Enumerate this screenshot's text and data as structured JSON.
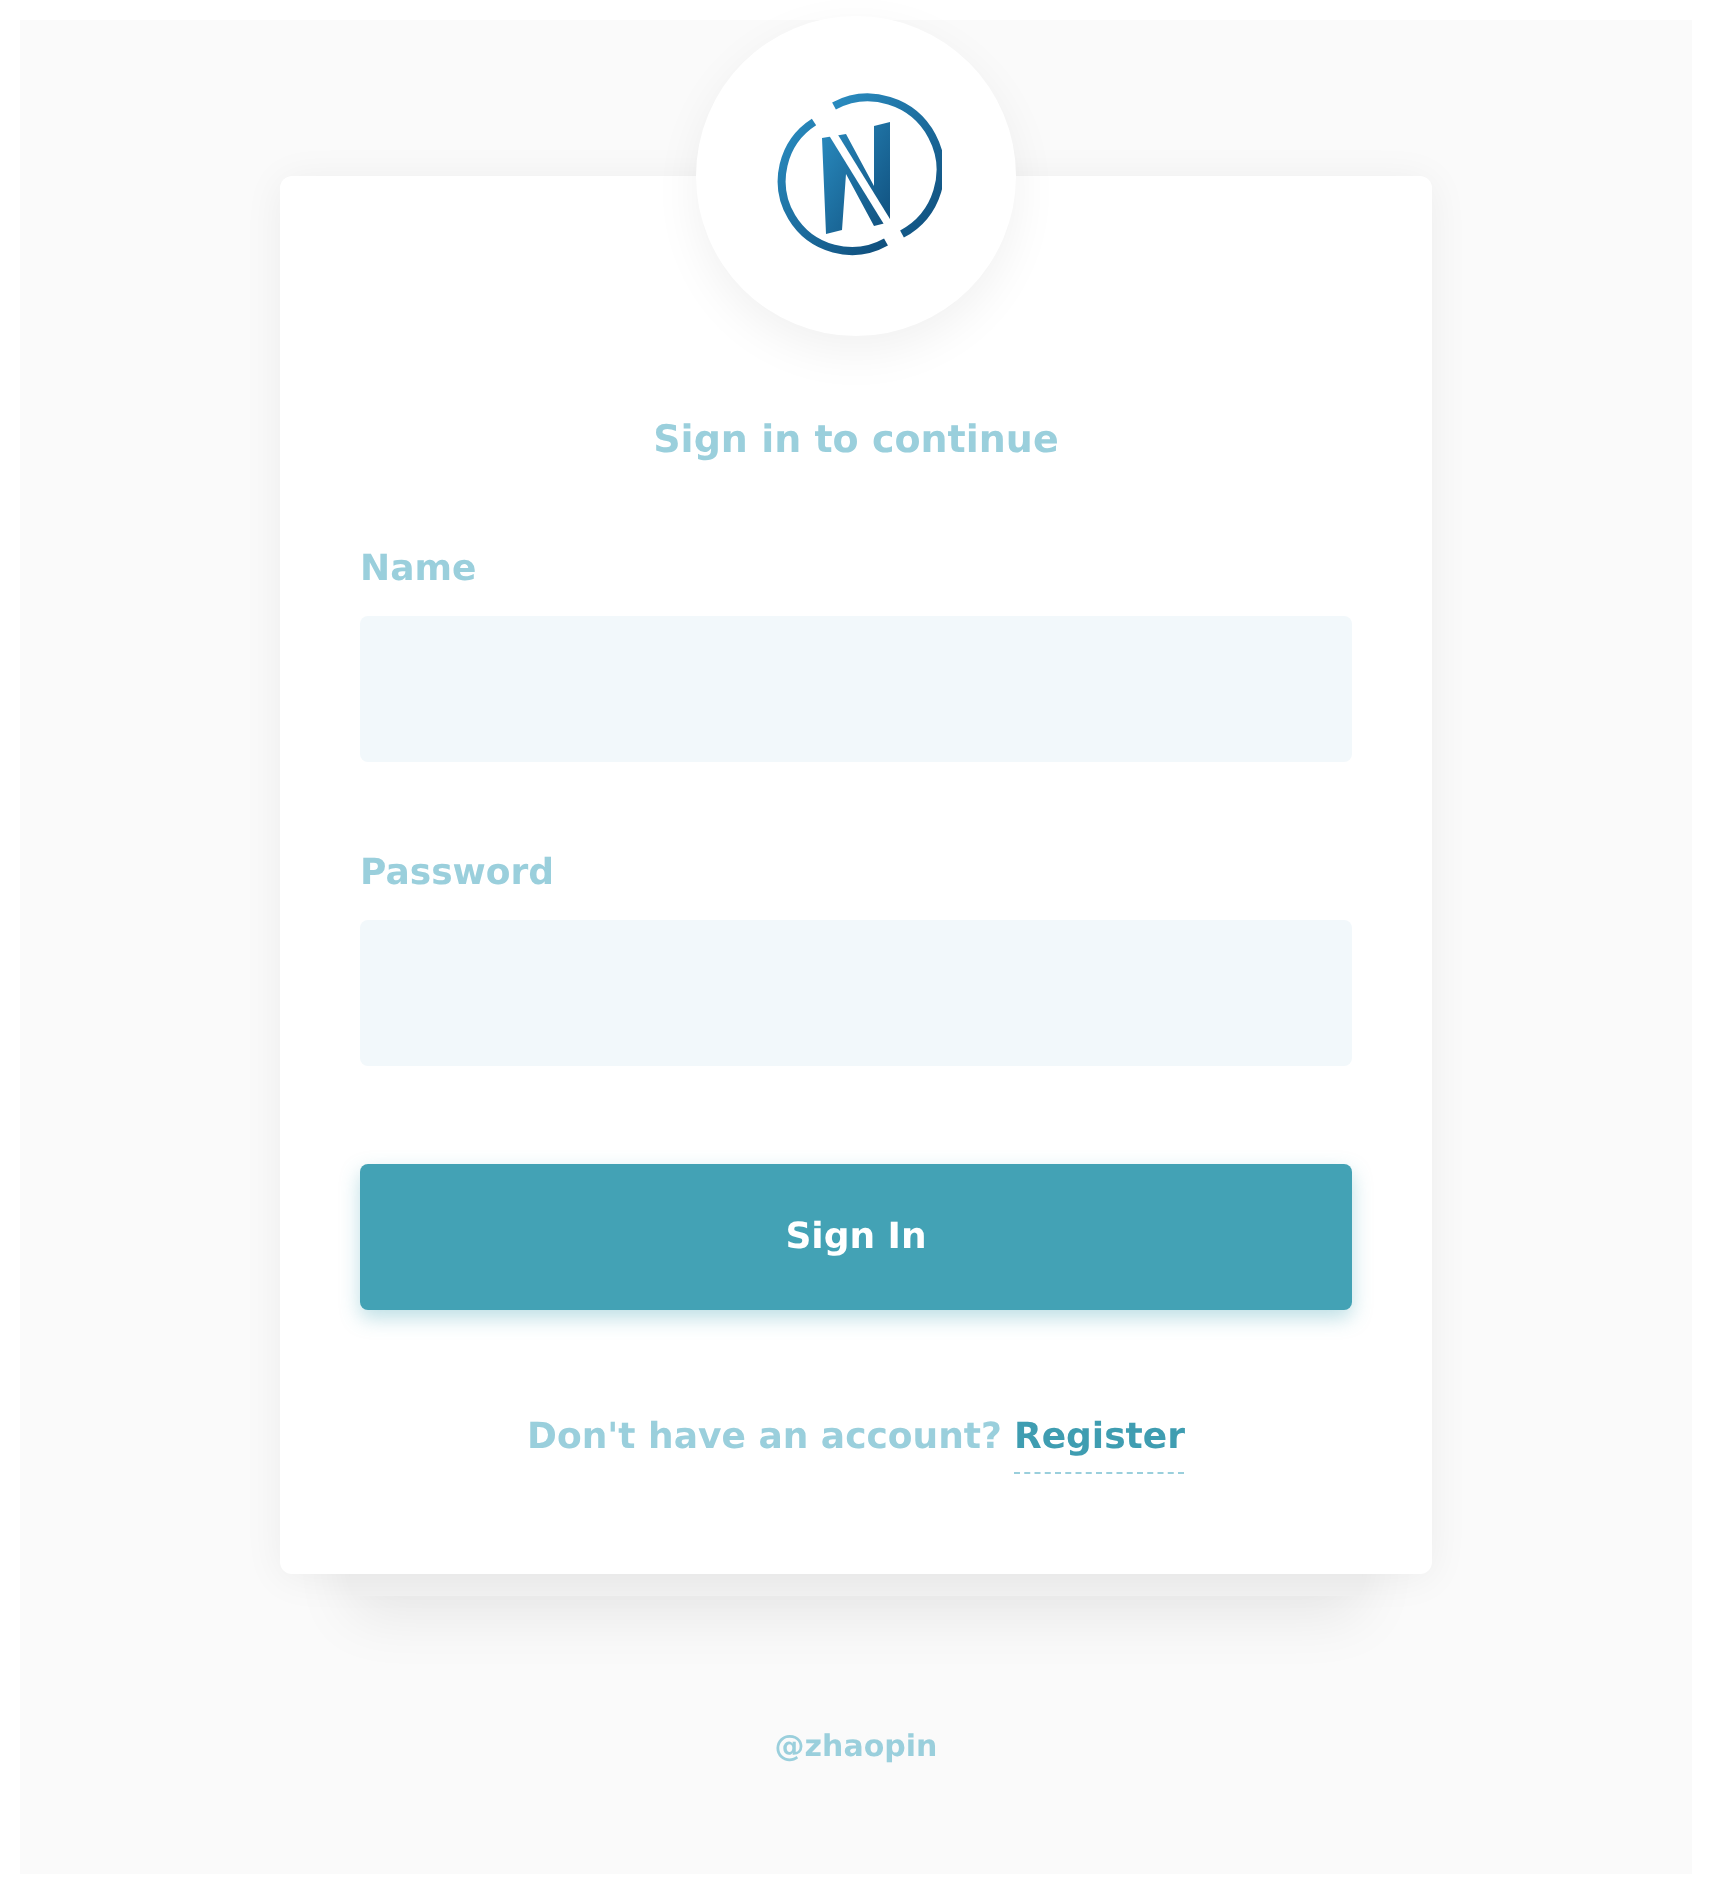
{
  "heading": "Sign in to continue",
  "fields": [
    {
      "label": "Name"
    },
    {
      "label": "Password"
    }
  ],
  "submit": "Sign In",
  "register_prompt": {
    "text": "Don't have an account?",
    "link": "Register"
  },
  "footer": "@zhaopin"
}
